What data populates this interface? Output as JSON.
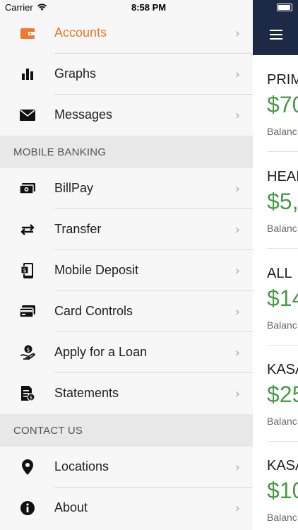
{
  "status_bar": {
    "carrier": "Carrier",
    "time": "8:58 PM"
  },
  "menu": {
    "items_top": [
      {
        "label": "Accounts",
        "icon": "wallet-icon"
      },
      {
        "label": "Graphs",
        "icon": "bar-chart-icon"
      },
      {
        "label": "Messages",
        "icon": "envelope-icon"
      }
    ],
    "section_banking": "MOBILE BANKING",
    "items_banking": [
      {
        "label": "BillPay",
        "icon": "bill-icon"
      },
      {
        "label": "Transfer",
        "icon": "transfer-arrows-icon"
      },
      {
        "label": "Mobile Deposit",
        "icon": "mobile-deposit-icon"
      },
      {
        "label": "Card Controls",
        "icon": "credit-card-icon"
      },
      {
        "label": "Apply for a Loan",
        "icon": "loan-hand-icon"
      },
      {
        "label": "Statements",
        "icon": "statement-icon"
      }
    ],
    "section_contact": "CONTACT US",
    "items_contact": [
      {
        "label": "Locations",
        "icon": "location-pin-icon"
      },
      {
        "label": "About",
        "icon": "info-icon"
      }
    ],
    "chevron": "›",
    "active_color": "#ea7a2f"
  },
  "main": {
    "accounts": [
      {
        "name": "PRIM",
        "amount": "$70",
        "balance": "Balanc"
      },
      {
        "name": "HEAI",
        "amount": "$5,",
        "balance": "Balanc"
      },
      {
        "name": "ALL",
        "amount": "$14",
        "balance": "Balanc"
      },
      {
        "name": "KASA",
        "amount": "$25",
        "balance": "Balanc"
      },
      {
        "name": "KASA",
        "amount": "$10",
        "balance": "Balanc"
      }
    ],
    "header_color": "#1d2a45",
    "amount_color": "#4a9b4a"
  }
}
